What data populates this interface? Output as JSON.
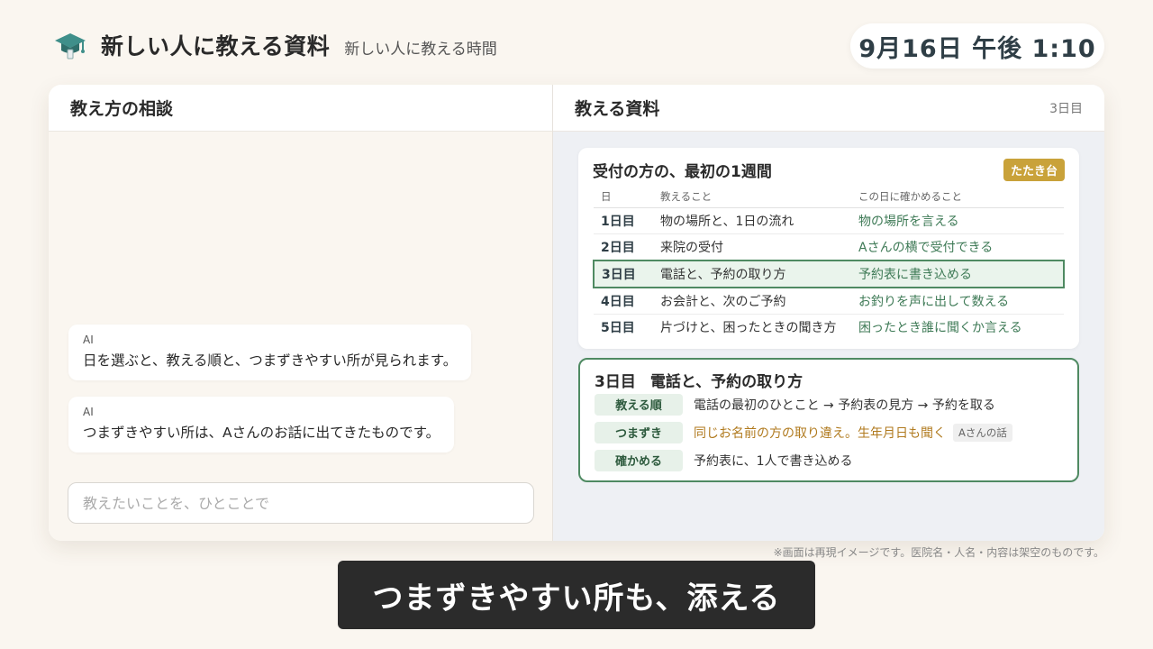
{
  "app": {
    "title": "新しい人に教える資料",
    "subtitle": "新しい人に教える時間",
    "clock": "9月16日 午後 1:10"
  },
  "chat": {
    "title": "教え方の相談",
    "messages": [
      {
        "sender": "AI",
        "text": "日を選ぶと、教える順と、つまずきやすい所が見られます。"
      },
      {
        "sender": "AI",
        "text": "つまずきやすい所は、Aさんのお話に出てきたものです。"
      }
    ],
    "input_placeholder": "教えたいことを、ひとことで"
  },
  "materials": {
    "title": "教える資料",
    "day_indicator": "3日目",
    "plan": {
      "title": "受付の方の、最初の1週間",
      "badge": "たたき台",
      "columns": [
        "日",
        "教えること",
        "この日に確かめること"
      ],
      "rows": [
        {
          "day": "1日目",
          "teach": "物の場所と、1日の流れ",
          "check": "物の場所を言える"
        },
        {
          "day": "2日目",
          "teach": "来院の受付",
          "check": "Aさんの横で受付できる"
        },
        {
          "day": "3日目",
          "teach": "電話と、予約の取り方",
          "check": "予約表に書き込める"
        },
        {
          "day": "4日目",
          "teach": "お会計と、次のご予約",
          "check": "お釣りを声に出して数える"
        },
        {
          "day": "5日目",
          "teach": "片づけと、困ったときの聞き方",
          "check": "困ったとき誰に聞くか言える"
        }
      ],
      "selected_index": 2
    },
    "detail": {
      "day": "3日目",
      "title": "電話と、予約の取り方",
      "order_label": "教える順",
      "order_value": "電話の最初のひとこと → 予約表の見方 → 予約を取る",
      "pitfall_label": "つまずき",
      "pitfall_value": "同じお名前の方の取り違え。生年月日も聞く",
      "pitfall_source": "Aさんの話",
      "confirm_label": "確かめる",
      "confirm_value": "予約表に、1人で書き込める"
    }
  },
  "disclaimer": "※画面は再現イメージです。医院名・人名・内容は架空のものです。",
  "caption": "つまずきやすい所も、添える",
  "colors": {
    "accent_green": "#4f8a62",
    "badge_gold": "#c9a23a",
    "warn_orange": "#b07a1e",
    "background": "#faf6f0"
  }
}
